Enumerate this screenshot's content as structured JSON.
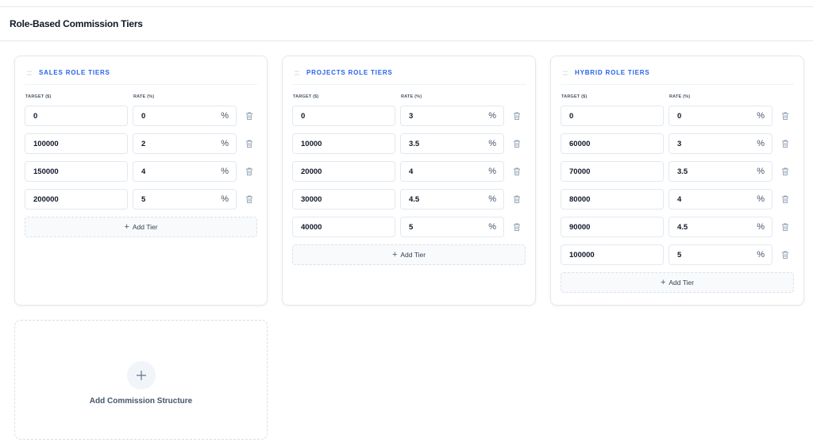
{
  "page": {
    "title": "Role-Based Commission Tiers"
  },
  "columns": {
    "target": "TARGET ($)",
    "rate": "RATE (%)"
  },
  "percent_symbol": "%",
  "add_tier_label": "Add Tier",
  "add_structure_label": "Add Commission Structure",
  "cards": [
    {
      "title": "SALES ROLE TIERS",
      "tiers": [
        {
          "target": "0",
          "rate": "0"
        },
        {
          "target": "100000",
          "rate": "2"
        },
        {
          "target": "150000",
          "rate": "4"
        },
        {
          "target": "200000",
          "rate": "5"
        }
      ]
    },
    {
      "title": "PROJECTS ROLE TIERS",
      "tiers": [
        {
          "target": "0",
          "rate": "3"
        },
        {
          "target": "10000",
          "rate": "3.5"
        },
        {
          "target": "20000",
          "rate": "4"
        },
        {
          "target": "30000",
          "rate": "4.5"
        },
        {
          "target": "40000",
          "rate": "5"
        }
      ]
    },
    {
      "title": "HYBRID ROLE TIERS",
      "tiers": [
        {
          "target": "0",
          "rate": "0"
        },
        {
          "target": "60000",
          "rate": "3"
        },
        {
          "target": "70000",
          "rate": "3.5"
        },
        {
          "target": "80000",
          "rate": "4"
        },
        {
          "target": "90000",
          "rate": "4.5"
        },
        {
          "target": "100000",
          "rate": "5"
        }
      ]
    }
  ],
  "colors": {
    "accent": "#2563eb",
    "border": "#e2e8f0",
    "muted": "#475569"
  }
}
